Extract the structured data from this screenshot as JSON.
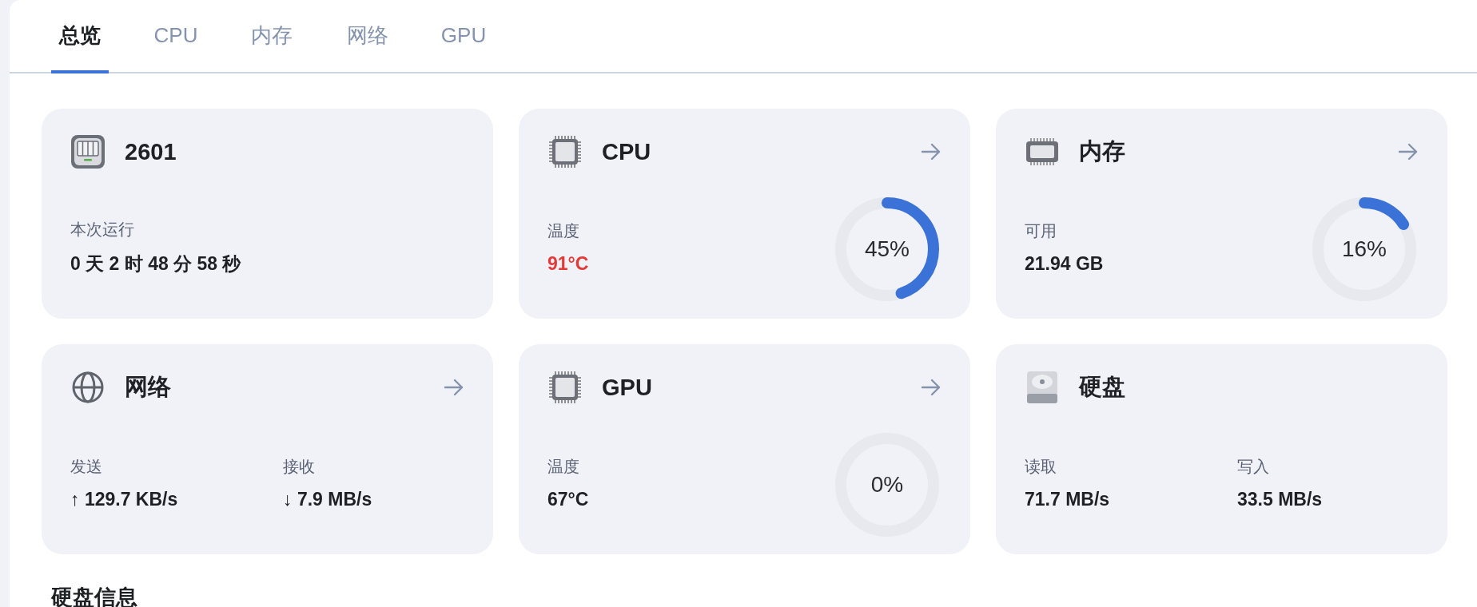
{
  "tabs": [
    {
      "label": "总览",
      "selected": true
    },
    {
      "label": "CPU",
      "selected": false
    },
    {
      "label": "内存",
      "selected": false
    },
    {
      "label": "网络",
      "selected": false
    },
    {
      "label": "GPU",
      "selected": false
    }
  ],
  "cards": [
    {
      "kind": "single",
      "title": "2601",
      "linked": false,
      "stats": [
        {
          "label": "本次运行",
          "value": "0 天 2 时 48 分 58 秒",
          "alert": false
        }
      ]
    },
    {
      "kind": "gauge",
      "title": "CPU",
      "linked": true,
      "stats": [
        {
          "label": "温度",
          "value": "91°C",
          "alert": true
        }
      ],
      "gauge": {
        "reading": "45%"
      }
    },
    {
      "kind": "gauge",
      "title": "内存",
      "linked": true,
      "stats": [
        {
          "label": "可用",
          "value": "21.94 GB",
          "alert": false
        }
      ],
      "gauge": {
        "reading": "16%"
      }
    },
    {
      "kind": "dual",
      "title": "网络",
      "linked": true,
      "stats": [
        {
          "label": "发送",
          "value": "↑ 129.7 KB/s",
          "alert": false
        },
        {
          "label": "接收",
          "value": "↓ 7.9 MB/s",
          "alert": false
        }
      ]
    },
    {
      "kind": "gauge",
      "title": "GPU",
      "linked": true,
      "stats": [
        {
          "label": "温度",
          "value": "67°C",
          "alert": false
        }
      ],
      "gauge": {
        "reading": "0%"
      }
    },
    {
      "kind": "dual",
      "title": "硬盘",
      "linked": false,
      "stats": [
        {
          "label": "读取",
          "value": "71.7 MB/s",
          "alert": false
        },
        {
          "label": "写入",
          "value": "33.5 MB/s",
          "alert": false
        }
      ]
    }
  ],
  "section_title": "硬盘信息"
}
